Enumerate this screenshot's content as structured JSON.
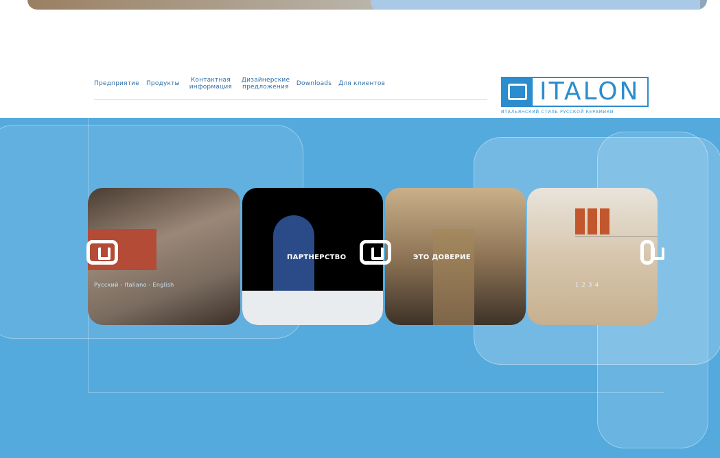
{
  "nav": {
    "items": [
      {
        "label": "Предприятие"
      },
      {
        "label": "Продукты"
      },
      {
        "label": "Контактная информация"
      },
      {
        "label": "Дизайнерские предложения"
      },
      {
        "label": "Downloads"
      },
      {
        "label": "Для клиентов"
      }
    ]
  },
  "logo": {
    "text": "ITALON",
    "subtitle": "ИТАЛЬЯНСКИЙ СТИЛЬ РУССКОЙ КЕРАМИКИ"
  },
  "carousel": {
    "captions": [
      "ПАРТНЕРСТВО",
      "ЭТО ДОВЕРИЕ"
    ]
  },
  "footer": {
    "languages": "Русский - Italiano - English",
    "pages": "1 2 3 4"
  }
}
